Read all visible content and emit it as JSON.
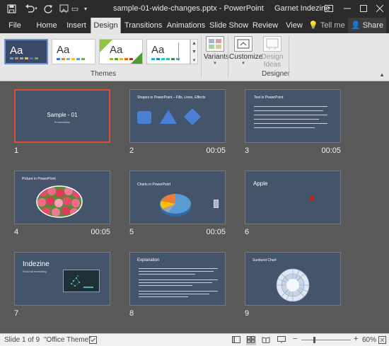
{
  "titlebar": {
    "title": "sample-01-wide-changes.pptx - PowerPoint",
    "user": "Garnet Indezine",
    "icons": [
      "save-icon",
      "undo-icon",
      "redo-icon",
      "format-icon",
      "more-icon",
      "ribbon-display-icon",
      "minimize-icon",
      "maximize-icon",
      "close-icon"
    ]
  },
  "tabs": [
    "File",
    "Home",
    "Insert",
    "Design",
    "Transitions",
    "Animations",
    "Slide Show",
    "Review",
    "View"
  ],
  "tell_me": "Tell me",
  "share": "Share",
  "ribbon": {
    "theme_thumb_text": "Aa",
    "themes_label": "Themes",
    "variants_label": "Variants",
    "customize_label": "Customize",
    "design_ideas_label": "Design Ideas",
    "designer_label": "Designer"
  },
  "slides": [
    {
      "num": "1",
      "time": "",
      "title": "Sample - 01",
      "subtitle": "Presentation"
    },
    {
      "num": "2",
      "time": "00:05",
      "title": "Shapes in PowerPoint – Fills, Lines, Effects"
    },
    {
      "num": "3",
      "time": "00:05",
      "title": "Text in PowerPoint"
    },
    {
      "num": "4",
      "time": "00:05",
      "title": "Picture in PowerPoint"
    },
    {
      "num": "5",
      "time": "00:05",
      "title": "Charts in PowerPoint"
    },
    {
      "num": "6",
      "time": "",
      "title": "Apple"
    },
    {
      "num": "7",
      "time": "",
      "title": "Indezine",
      "subtitle": "Fictional marketing"
    },
    {
      "num": "8",
      "time": "",
      "title": "Explanation"
    },
    {
      "num": "9",
      "time": "",
      "title": "Sunburst Chart"
    }
  ],
  "statusbar": {
    "slide_info": "Slide 1 of 9",
    "theme": "\"Office Theme\"",
    "zoom": "60%"
  },
  "colors": {
    "slide_bg": "#44546a",
    "selection": "#e24a2e",
    "workspace": "#595959",
    "titlebar": "#2b2b2b"
  }
}
